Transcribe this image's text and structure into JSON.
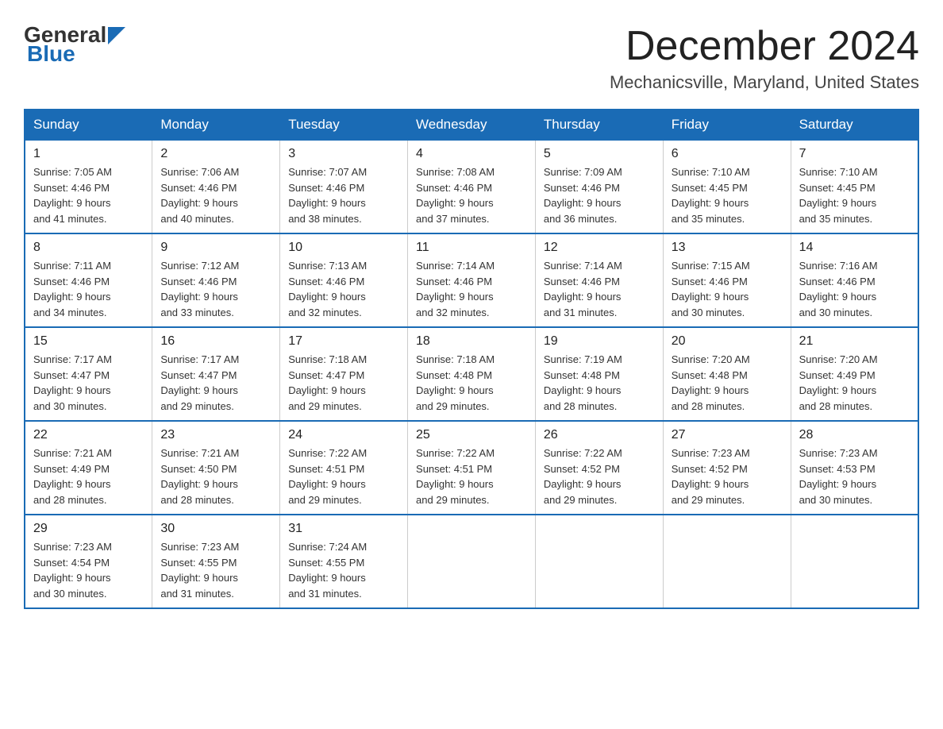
{
  "logo": {
    "general": "General",
    "blue": "Blue",
    "arrow_color": "#1a6bb5"
  },
  "header": {
    "month": "December 2024",
    "location": "Mechanicsville, Maryland, United States"
  },
  "weekdays": [
    "Sunday",
    "Monday",
    "Tuesday",
    "Wednesday",
    "Thursday",
    "Friday",
    "Saturday"
  ],
  "weeks": [
    [
      {
        "day": "1",
        "sunrise": "7:05 AM",
        "sunset": "4:46 PM",
        "daylight": "9 hours and 41 minutes."
      },
      {
        "day": "2",
        "sunrise": "7:06 AM",
        "sunset": "4:46 PM",
        "daylight": "9 hours and 40 minutes."
      },
      {
        "day": "3",
        "sunrise": "7:07 AM",
        "sunset": "4:46 PM",
        "daylight": "9 hours and 38 minutes."
      },
      {
        "day": "4",
        "sunrise": "7:08 AM",
        "sunset": "4:46 PM",
        "daylight": "9 hours and 37 minutes."
      },
      {
        "day": "5",
        "sunrise": "7:09 AM",
        "sunset": "4:46 PM",
        "daylight": "9 hours and 36 minutes."
      },
      {
        "day": "6",
        "sunrise": "7:10 AM",
        "sunset": "4:45 PM",
        "daylight": "9 hours and 35 minutes."
      },
      {
        "day": "7",
        "sunrise": "7:10 AM",
        "sunset": "4:45 PM",
        "daylight": "9 hours and 35 minutes."
      }
    ],
    [
      {
        "day": "8",
        "sunrise": "7:11 AM",
        "sunset": "4:46 PM",
        "daylight": "9 hours and 34 minutes."
      },
      {
        "day": "9",
        "sunrise": "7:12 AM",
        "sunset": "4:46 PM",
        "daylight": "9 hours and 33 minutes."
      },
      {
        "day": "10",
        "sunrise": "7:13 AM",
        "sunset": "4:46 PM",
        "daylight": "9 hours and 32 minutes."
      },
      {
        "day": "11",
        "sunrise": "7:14 AM",
        "sunset": "4:46 PM",
        "daylight": "9 hours and 32 minutes."
      },
      {
        "day": "12",
        "sunrise": "7:14 AM",
        "sunset": "4:46 PM",
        "daylight": "9 hours and 31 minutes."
      },
      {
        "day": "13",
        "sunrise": "7:15 AM",
        "sunset": "4:46 PM",
        "daylight": "9 hours and 30 minutes."
      },
      {
        "day": "14",
        "sunrise": "7:16 AM",
        "sunset": "4:46 PM",
        "daylight": "9 hours and 30 minutes."
      }
    ],
    [
      {
        "day": "15",
        "sunrise": "7:17 AM",
        "sunset": "4:47 PM",
        "daylight": "9 hours and 30 minutes."
      },
      {
        "day": "16",
        "sunrise": "7:17 AM",
        "sunset": "4:47 PM",
        "daylight": "9 hours and 29 minutes."
      },
      {
        "day": "17",
        "sunrise": "7:18 AM",
        "sunset": "4:47 PM",
        "daylight": "9 hours and 29 minutes."
      },
      {
        "day": "18",
        "sunrise": "7:18 AM",
        "sunset": "4:48 PM",
        "daylight": "9 hours and 29 minutes."
      },
      {
        "day": "19",
        "sunrise": "7:19 AM",
        "sunset": "4:48 PM",
        "daylight": "9 hours and 28 minutes."
      },
      {
        "day": "20",
        "sunrise": "7:20 AM",
        "sunset": "4:48 PM",
        "daylight": "9 hours and 28 minutes."
      },
      {
        "day": "21",
        "sunrise": "7:20 AM",
        "sunset": "4:49 PM",
        "daylight": "9 hours and 28 minutes."
      }
    ],
    [
      {
        "day": "22",
        "sunrise": "7:21 AM",
        "sunset": "4:49 PM",
        "daylight": "9 hours and 28 minutes."
      },
      {
        "day": "23",
        "sunrise": "7:21 AM",
        "sunset": "4:50 PM",
        "daylight": "9 hours and 28 minutes."
      },
      {
        "day": "24",
        "sunrise": "7:22 AM",
        "sunset": "4:51 PM",
        "daylight": "9 hours and 29 minutes."
      },
      {
        "day": "25",
        "sunrise": "7:22 AM",
        "sunset": "4:51 PM",
        "daylight": "9 hours and 29 minutes."
      },
      {
        "day": "26",
        "sunrise": "7:22 AM",
        "sunset": "4:52 PM",
        "daylight": "9 hours and 29 minutes."
      },
      {
        "day": "27",
        "sunrise": "7:23 AM",
        "sunset": "4:52 PM",
        "daylight": "9 hours and 29 minutes."
      },
      {
        "day": "28",
        "sunrise": "7:23 AM",
        "sunset": "4:53 PM",
        "daylight": "9 hours and 30 minutes."
      }
    ],
    [
      {
        "day": "29",
        "sunrise": "7:23 AM",
        "sunset": "4:54 PM",
        "daylight": "9 hours and 30 minutes."
      },
      {
        "day": "30",
        "sunrise": "7:23 AM",
        "sunset": "4:55 PM",
        "daylight": "9 hours and 31 minutes."
      },
      {
        "day": "31",
        "sunrise": "7:24 AM",
        "sunset": "4:55 PM",
        "daylight": "9 hours and 31 minutes."
      },
      null,
      null,
      null,
      null
    ]
  ],
  "labels": {
    "sunrise": "Sunrise:",
    "sunset": "Sunset:",
    "daylight": "Daylight:"
  }
}
